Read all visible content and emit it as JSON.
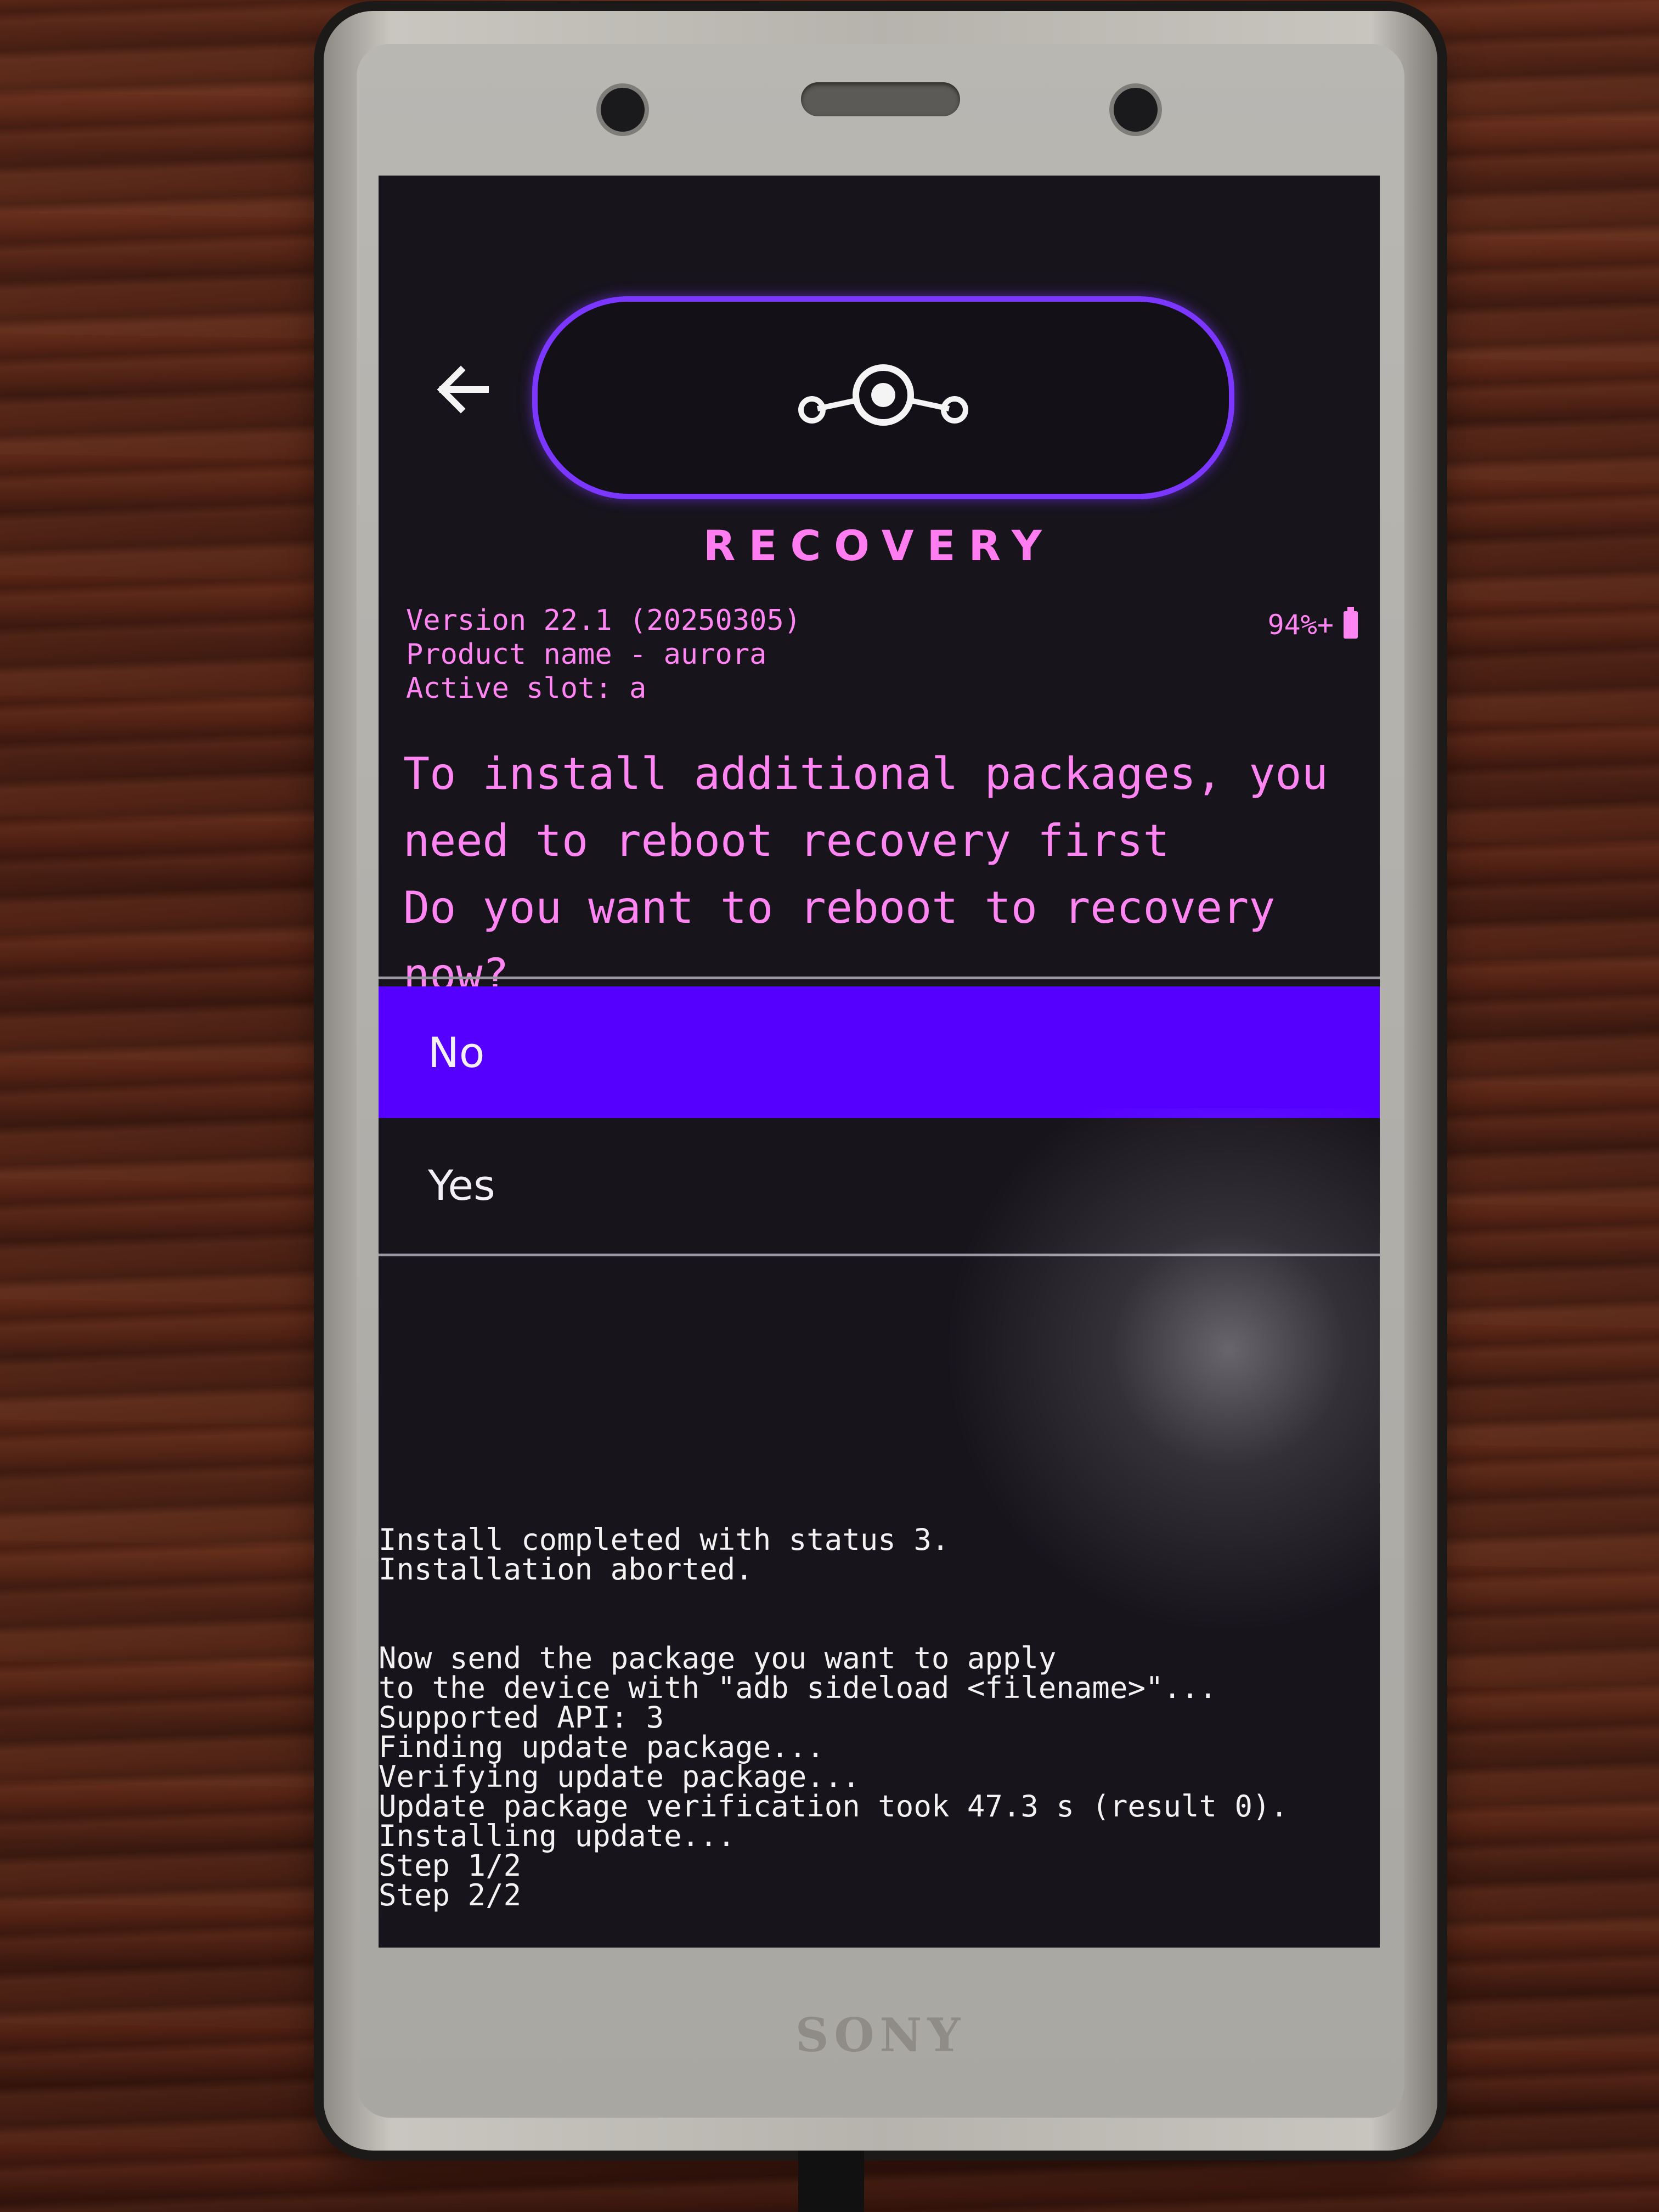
{
  "device": {
    "brand": "SONY"
  },
  "header": {
    "back_icon": "arrow-left-icon",
    "logo_icon": "lineageos-logo-icon",
    "title": "RECOVERY"
  },
  "info": {
    "version": "Version 22.1 (20250305)",
    "product": "Product name - aurora",
    "slot": "Active slot: a",
    "battery": "94%+",
    "battery_icon": "battery-icon"
  },
  "prompt": {
    "line1": "To install additional packages, you",
    "line2": "need to reboot recovery first",
    "line3": "Do you want to reboot to recovery now?"
  },
  "options": [
    {
      "label": "No",
      "selected": true
    },
    {
      "label": "Yes",
      "selected": false
    }
  ],
  "log": {
    "lines": [
      "Install completed with status 3.",
      "Installation aborted.",
      "",
      "",
      "Now send the package you want to apply",
      "to the device with \"adb sideload <filename>\"...",
      "Supported API: 3",
      "Finding update package...",
      "Verifying update package...",
      "Update package verification took 47.3 s (result 0).",
      "Installing update...",
      "Step 1/2",
      "Step 2/2"
    ]
  },
  "colors": {
    "accent": "#5500ff",
    "text_pink": "#ff85f3",
    "pill_border": "#7b36ff",
    "screen_bg": "#17141c"
  }
}
